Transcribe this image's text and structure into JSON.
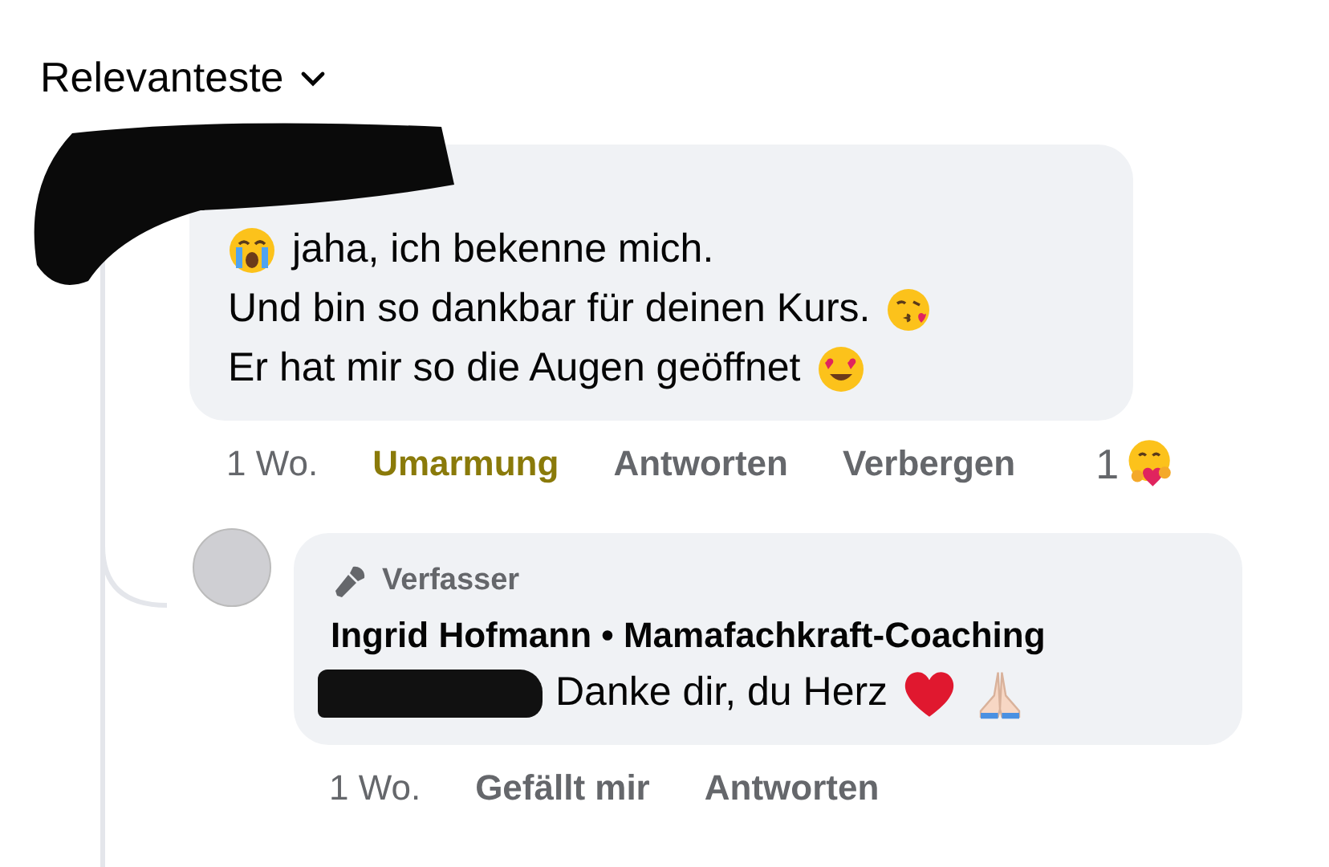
{
  "sort": {
    "label": "Relevanteste"
  },
  "comment": {
    "lines": [
      "jaha, ich bekenne mich.",
      "Und bin so dankbar für deinen Kurs.",
      "Er hat mir so die Augen geöffnet"
    ],
    "time": "1 Wo.",
    "actions": [
      {
        "label": "Umarmung",
        "selected": true
      },
      {
        "label": "Antworten",
        "selected": false
      },
      {
        "label": "Verbergen",
        "selected": false
      }
    ],
    "reaction_count": "1"
  },
  "reply": {
    "badge": "Verfasser",
    "author": "Ingrid Hofmann • Mamafachkraft-Coaching",
    "text": "Danke dir, du Herz",
    "time": "1 Wo.",
    "actions": [
      {
        "label": "Gefällt mir",
        "selected": false
      },
      {
        "label": "Antworten",
        "selected": false
      }
    ]
  }
}
